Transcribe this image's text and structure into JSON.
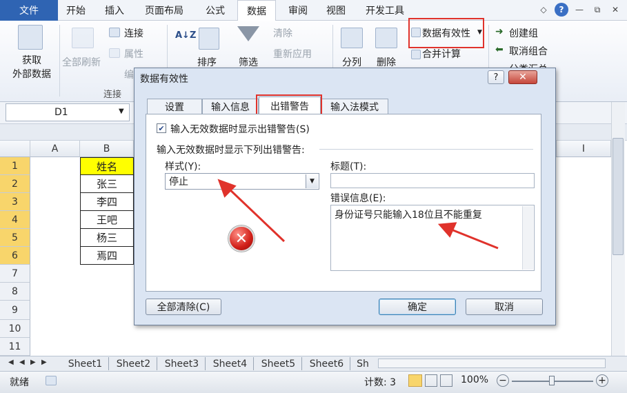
{
  "ribbon_tabs": [
    "文件",
    "开始",
    "插入",
    "页面布局",
    "公式",
    "数据",
    "审阅",
    "视图",
    "开发工具"
  ],
  "active_tab": "数据",
  "window_controls": {
    "minimize_ribbon": "◇",
    "help": "?",
    "minimize": "—",
    "restore": "⧉",
    "close": "✕"
  },
  "ribbon": {
    "get_external": "获取\n外部数据",
    "refresh_all": "全部刷新",
    "connections": "连接",
    "properties": "属性",
    "edit_links": "编",
    "group_connections": "连接",
    "sort": "排序",
    "filter": "筛选",
    "clear": "清除",
    "reapply": "重新应用",
    "split": "分列",
    "delete": "删除",
    "data_validation": "数据有效性",
    "consolidate": "合并计算",
    "group": "创建组",
    "ungroup": "取消组合",
    "subtotal": "分类汇总"
  },
  "namebox": "D1",
  "columns": [
    "A",
    "B",
    "I"
  ],
  "rows": [
    "1",
    "2",
    "3",
    "4",
    "5",
    "6",
    "7",
    "8",
    "9",
    "10",
    "11"
  ],
  "cells_b": [
    "姓名",
    "张三",
    "李四",
    "王吧",
    "杨三",
    "焉四"
  ],
  "sheet_tabs": [
    "Sheet1",
    "Sheet2",
    "Sheet3",
    "Sheet4",
    "Sheet5",
    "Sheet6",
    "Sh"
  ],
  "status": {
    "ready": "就绪",
    "count": "计数: 3",
    "zoom": "100%"
  },
  "dialog": {
    "title": "数据有效性",
    "tabs": [
      "设置",
      "输入信息",
      "出错警告",
      "输入法模式"
    ],
    "active_tab": "出错警告",
    "show_alert_label": "输入无效数据时显示出错警告(S)",
    "show_alert_checked": true,
    "section_label": "输入无效数据时显示下列出错警告:",
    "style_label": "样式(Y):",
    "style_value": "停止",
    "title_label": "标题(T):",
    "title_value": "",
    "message_label": "错误信息(E):",
    "message_value": "身份证号只能输入18位且不能重复",
    "clear_all_button": "全部清除(C)",
    "ok_button": "确定",
    "cancel_button": "取消"
  },
  "colors": {
    "accent": "#2f64b3",
    "highlight": "#e0322b",
    "header_yellow": "#ffff00",
    "selected_row": "#f8d56b"
  }
}
